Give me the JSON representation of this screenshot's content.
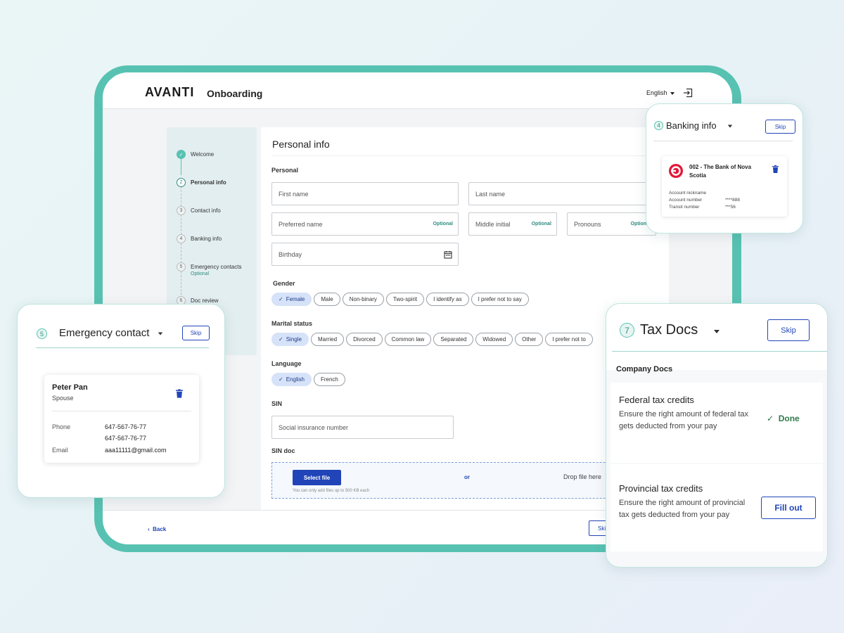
{
  "header": {
    "logo": "AVANTI",
    "title": "Onboarding",
    "language": "English"
  },
  "stepper": {
    "steps": [
      {
        "num": "",
        "label": "Welcome",
        "sub": ""
      },
      {
        "num": "2",
        "label": "Personal info",
        "sub": ""
      },
      {
        "num": "3",
        "label": "Contact info",
        "sub": ""
      },
      {
        "num": "4",
        "label": "Banking info",
        "sub": ""
      },
      {
        "num": "5",
        "label": "Emergency contacts",
        "sub": "Optional"
      },
      {
        "num": "6",
        "label": "Doc review",
        "sub": ""
      }
    ]
  },
  "form": {
    "title": "Personal info",
    "personal_label": "Personal",
    "first_name_placeholder": "First name",
    "last_name_placeholder": "Last name",
    "preferred_name_placeholder": "Preferred name",
    "middle_initial_placeholder": "Middle initial",
    "pronouns_placeholder": "Pronouns",
    "optional": "Optional",
    "birthday_placeholder": "Birthday",
    "gender_label": "Gender",
    "gender_options": [
      "Female",
      "Male",
      "Non-binary",
      "Two-spirit",
      "I identify as",
      "I prefer not to say"
    ],
    "marital_label": "Marital status",
    "marital_options": [
      "Single",
      "Married",
      "Divorced",
      "Common law",
      "Separated",
      "Widowed",
      "Other",
      "I prefer not to"
    ],
    "language_label": "Language",
    "language_options": [
      "English",
      "French"
    ],
    "sin_label": "SIN",
    "sin_placeholder": "Social insurance number",
    "sin_doc_label": "SIN doc",
    "select_file": "Select file",
    "or": "or",
    "drop_text": "Drop file here",
    "file_hint": "You can only add files up to 500 KB each"
  },
  "footer": {
    "back": "Back",
    "skip": "Skip"
  },
  "banking_card": {
    "num": "4",
    "title": "Banking info",
    "skip": "Skip",
    "bank_name": "002 - The Bank of Nova Scotia",
    "rows": [
      {
        "label": "Account nickname",
        "value": ""
      },
      {
        "label": "Account number",
        "value": "****888"
      },
      {
        "label": "Transit number",
        "value": "***56"
      }
    ]
  },
  "emergency_card": {
    "num": "5",
    "title": "Emergency contact",
    "skip": "Skip",
    "name": "Peter Pan",
    "relation": "Spouse",
    "phone_label": "Phone",
    "phone_1": "647-567-76-77",
    "phone_2": "647-567-76-77",
    "email_label": "Email",
    "email": "aaa11111@gmail.com"
  },
  "tax_card": {
    "num": "7",
    "title": "Tax Docs",
    "skip": "Skip",
    "section": "Company Docs",
    "items": [
      {
        "title": "Federal tax credits",
        "desc": "Ensure the right amount of federal tax gets deducted from your pay",
        "status": "Done"
      },
      {
        "title": "Provincial tax credits",
        "desc": "Ensure the right amount of provincial tax gets deducted from your pay",
        "action": "Fill out"
      }
    ]
  },
  "colors": {
    "teal": "#58c2b2",
    "primary_blue": "#2145b8",
    "chip_selected": "#d6e2f8",
    "bank_red": "#e31837"
  }
}
